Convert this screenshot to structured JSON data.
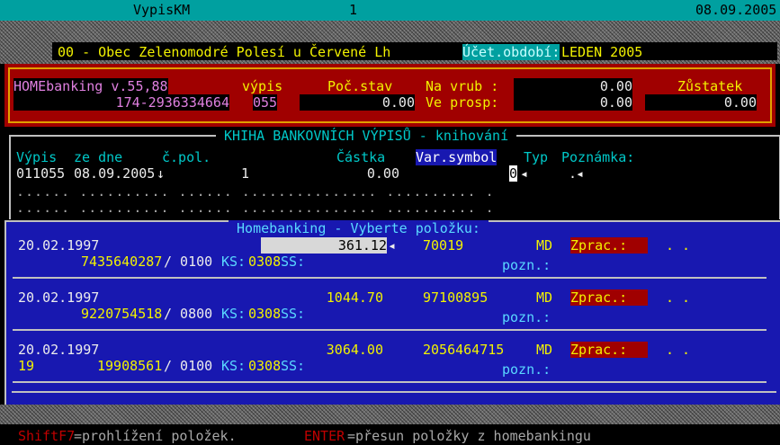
{
  "title_bar": {
    "app_name": "VypisKM",
    "window_no": "1",
    "date": "08.09.2005"
  },
  "org_line": {
    "org_text": "00 - Obec Zelenomodré Polesí u Červené Lh",
    "period_label": "Účet.období:",
    "period_value": "LEDEN 2005"
  },
  "header_panel": {
    "home_label": "HOMEbanking v.55,88",
    "account": "174-2936334664",
    "vypis_label": "výpis",
    "vypis_value": "055",
    "poc_stav_label": "Poč.stav",
    "poc_stav_value": "0.00",
    "na_vrub_label": "Na vrub :",
    "na_vrub_value": "0.00",
    "ve_prosp_label": "Ve prosp:",
    "ve_prosp_value": "0.00",
    "zustatek_label": "Zůstatek",
    "zustatek_value": "0.00"
  },
  "ledger": {
    "title": " KHIHA BANKOVNÍCH VÝPISŮ - knihování ",
    "headers": {
      "vypis": "Výpis",
      "ze_dne": "ze dne",
      "c_pol": "č.pol.",
      "castka": "Částka",
      "var_symbol": "Var.symbol",
      "typ": "Typ",
      "poznamka": "Poznámka:"
    },
    "row": {
      "vypis": "011055",
      "date": "08.09.2005",
      "c_pol": "1",
      "castka": "0.00",
      "typ": "0",
      "poznamka": "."
    },
    "dots1": "...... .......... ...... ............... .......... .",
    "dots2": "...... .......... ...... ............... .......... ."
  },
  "homebanking": {
    "title": " Homebanking - Vyberte položku: ",
    "items": [
      {
        "date": "20.02.1997",
        "amount": "361.12",
        "var_symbol": "70019",
        "type": "MD",
        "status": "Zprac.:",
        "dots": ". .",
        "left2": "",
        "account": "7435640287",
        "bank": "/ 0100",
        "ks_label": "KS:",
        "ks": "0308",
        "ss_label": "SS:",
        "pozn": "pozn.:"
      },
      {
        "date": "20.02.1997",
        "amount": "1044.70",
        "var_symbol": "97100895",
        "type": "MD",
        "status": "Zprac.:",
        "dots": ". .",
        "left2": "",
        "account": "9220754518",
        "bank": "/ 0800",
        "ks_label": "KS:",
        "ks": "0308",
        "ss_label": "SS:",
        "pozn": "pozn.:"
      },
      {
        "date": "20.02.1997",
        "amount": "3064.00",
        "var_symbol": "2056464715",
        "type": "MD",
        "status": "Zprac.:",
        "dots": ". .",
        "left2": "19",
        "account": "19908561",
        "bank": "/ 0100",
        "ks_label": "KS:",
        "ks": "0308",
        "ss_label": "SS:",
        "pozn": "pozn.:"
      }
    ]
  },
  "status_bar": {
    "key1": "ShiftF7",
    "text1": "=prohlížení položek.",
    "key2": "ENTER",
    "text2": "=přesun položky z homebankingu"
  },
  "colors": {
    "cyan": "#00c8c8",
    "yellow": "#f2f200",
    "red_panel": "#a00000",
    "blue_panel": "#1818b0",
    "title_bar": "#00a0a0"
  }
}
